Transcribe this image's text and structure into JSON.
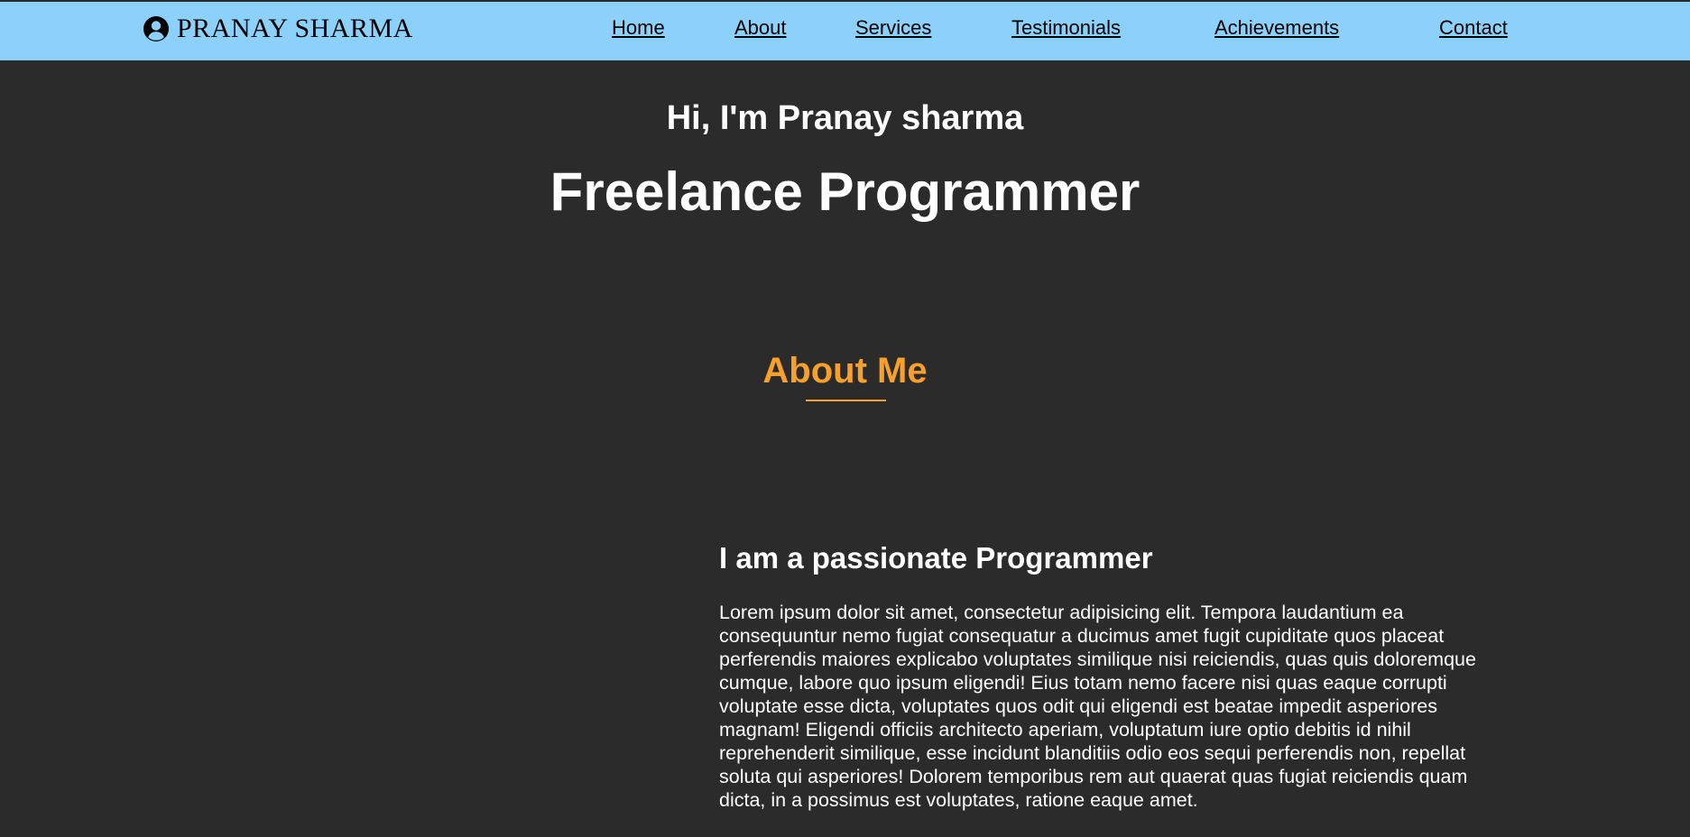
{
  "header": {
    "logo_icon": "user-circle-icon",
    "logo_text": "PRANAY SHARMA",
    "nav": [
      {
        "label": "Home"
      },
      {
        "label": "About"
      },
      {
        "label": "Services"
      },
      {
        "label": "Testimonials"
      },
      {
        "label": "Achievements"
      },
      {
        "label": "Contact"
      }
    ]
  },
  "hero": {
    "greeting": "Hi, I'm Pranay sharma",
    "title": "Freelance Programmer"
  },
  "about": {
    "section_title": "About Me",
    "heading": "I am a passionate Programmer",
    "paragraph": "Lorem ipsum dolor sit amet, consectetur adipisicing elit. Tempora laudantium ea consequuntur nemo fugiat consequatur a ducimus amet fugit cupiditate quos placeat perferendis maiores explicabo voluptates similique nisi reiciendis, quas quis doloremque cumque, labore quo ipsum eligendi! Eius totam nemo facere nisi quas eaque corrupti voluptate esse dicta, voluptates quos odit qui eligendi est beatae impedit asperiores magnam! Eligendi officiis architecto aperiam, voluptatum iure optio debitis id nihil reprehenderit similique, esse incidunt blanditiis odio eos sequi perferendis non, repellat soluta qui asperiores! Dolorem temporibus rem aut quaerat quas fugiat reiciendis quam dicta, in a possimus est voluptates, ratione eaque amet."
  },
  "colors": {
    "navbar_background": "#8bd1fb",
    "page_background": "#2b2b2b",
    "accent": "#f7a12b",
    "text_primary": "#ffffff"
  }
}
